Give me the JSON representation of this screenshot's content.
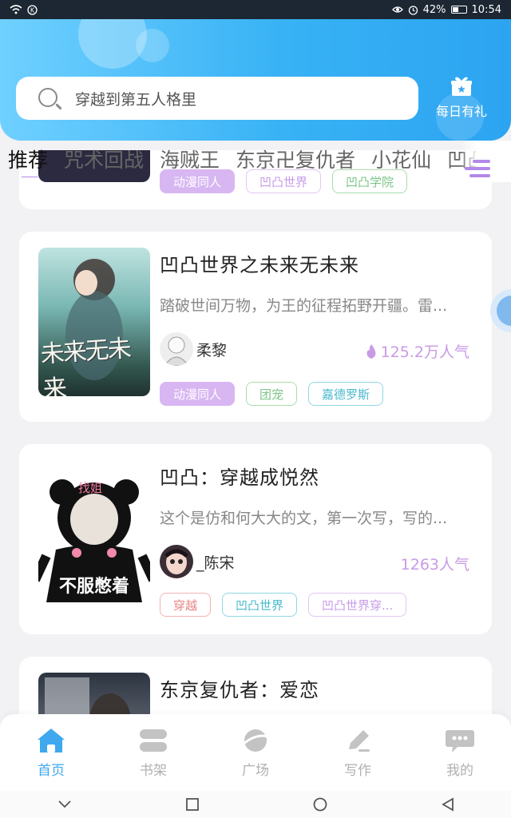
{
  "status_bar": {
    "battery": "42%",
    "time": "10:54"
  },
  "header": {
    "search_placeholder": "穿越到第五人格里",
    "gift_label": "每日有礼"
  },
  "tabs": [
    "推荐",
    "咒术回战",
    "海贼王",
    "东京卍复仇者",
    "小花仙",
    "凹凸"
  ],
  "colors": {
    "accent_blue": "#3fa8ee",
    "accent_purple": "#b388e8",
    "popularity": "#c99ae6"
  },
  "partial_card": {
    "tags": [
      "动漫同人",
      "凹凸世界",
      "凹凸学院"
    ]
  },
  "cards": [
    {
      "title": "凹凸世界之未来无未来",
      "desc": "踏破世间万物，为王的征程拓野开疆。雷...",
      "author": "柔黎",
      "popularity": "125.2万人气",
      "tags": [
        "动漫同人",
        "团宠",
        "嘉德罗斯"
      ],
      "cover_text": "未来无未来"
    },
    {
      "title": "凹凸：穿越成悦然",
      "desc": "这个是仿和何大大的文，第一次写，写的...",
      "author": "_陈宋",
      "popularity": "1263人气",
      "tags": [
        "穿越",
        "凹凸世界",
        "凹凸世界穿..."
      ],
      "cover_text_top": "找姐",
      "cover_text_bottom": "不服憋着"
    },
    {
      "title": "东京复仇者：爱恋"
    }
  ],
  "bottom_nav": [
    {
      "label": "首页",
      "icon": "home-icon"
    },
    {
      "label": "书架",
      "icon": "bookshelf-icon"
    },
    {
      "label": "广场",
      "icon": "planet-icon"
    },
    {
      "label": "写作",
      "icon": "pencil-icon"
    },
    {
      "label": "我的",
      "icon": "chat-bubble-icon"
    }
  ]
}
